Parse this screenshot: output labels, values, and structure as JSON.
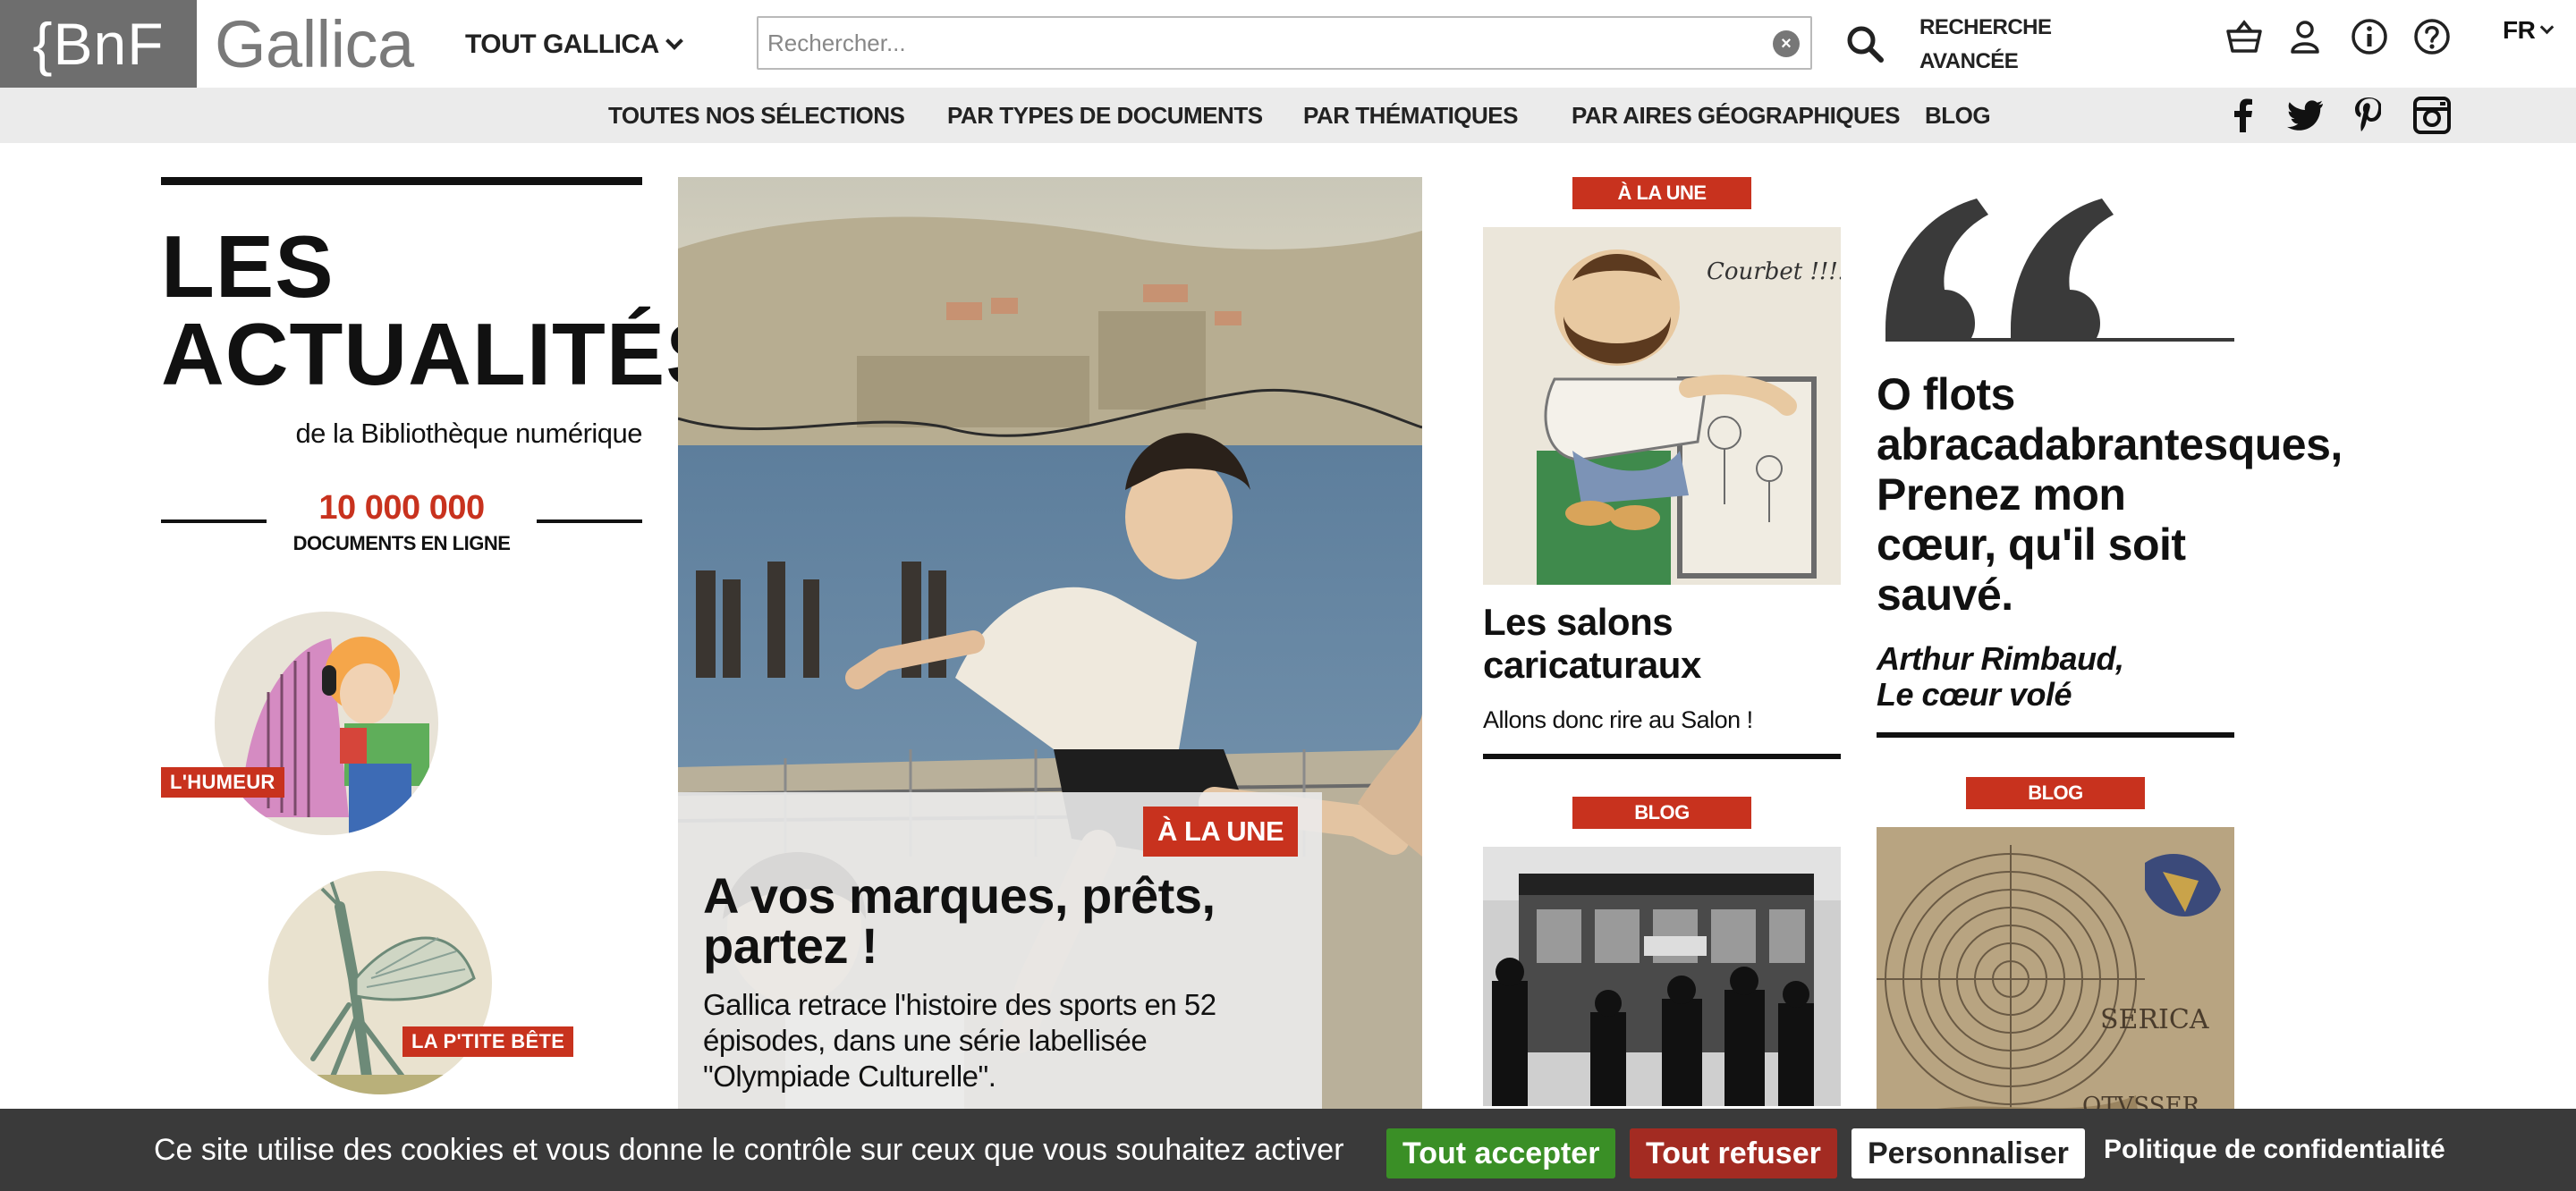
{
  "header": {
    "bnf_logo": "{BnF",
    "gallica_logo": "Gallica",
    "tout_gallica": "TOUT GALLICA",
    "search_placeholder": "Rechercher...",
    "advanced_search": "RECHERCHE AVANCÉE",
    "language": "FR",
    "icons": [
      "basket-icon",
      "user-icon",
      "info-icon",
      "help-icon"
    ]
  },
  "nav": {
    "items": [
      "TOUTES NOS SÉLECTIONS",
      "PAR TYPES DE DOCUMENTS",
      "PAR THÉMATIQUES",
      "PAR AIRES GÉOGRAPHIQUES",
      "BLOG"
    ],
    "social": [
      "facebook-icon",
      "twitter-icon",
      "pinterest-icon",
      "instagram-icon"
    ]
  },
  "left": {
    "title_line1": "LES",
    "title_line2": "ACTUALITÉS",
    "subtitle": "de la Bibliothèque numérique",
    "stat_number": "10 000 000",
    "stat_label": "DOCUMENTS EN LIGNE",
    "tag_humeur": "L'HUMEUR",
    "tag_ptite_bete": "LA P'TITE BÊTE"
  },
  "hero": {
    "tag": "À LA UNE",
    "title": "A vos marques, prêts, partez !",
    "description": "Gallica retrace l'histoire des sports en 52 épisodes, dans une série labellisée \"Olympiade Culturelle\"."
  },
  "col3": {
    "tag1": "À LA UNE",
    "card1_title": "Les salons caricaturaux",
    "card1_desc": "Allons donc rire au Salon !",
    "card1_caption": "Courbet !!!!",
    "tag2": "BLOG"
  },
  "col4": {
    "quote": "O flots abracadabrantesques, Prenez mon cœur, qu'il soit sauvé.",
    "author_line1": "Arthur Rimbaud,",
    "author_line2": "Le cœur volé",
    "tag": "BLOG",
    "map_labels": [
      "SERICA",
      "OTVSSER"
    ]
  },
  "cookie": {
    "message": "Ce site utilise des cookies et vous donne le contrôle sur ceux que vous souhaitez activer",
    "accept": "Tout accepter",
    "refuse": "Tout refuser",
    "customize": "Personnaliser",
    "privacy": "Politique de confidentialité",
    "colors": {
      "accept": "#3a8f26",
      "refuse": "#a32b22",
      "customize": "#ffffff"
    }
  },
  "colors": {
    "accent": "#c8321e",
    "nav_bg": "#ebebeb",
    "logo_bg": "#6e6e6e"
  }
}
